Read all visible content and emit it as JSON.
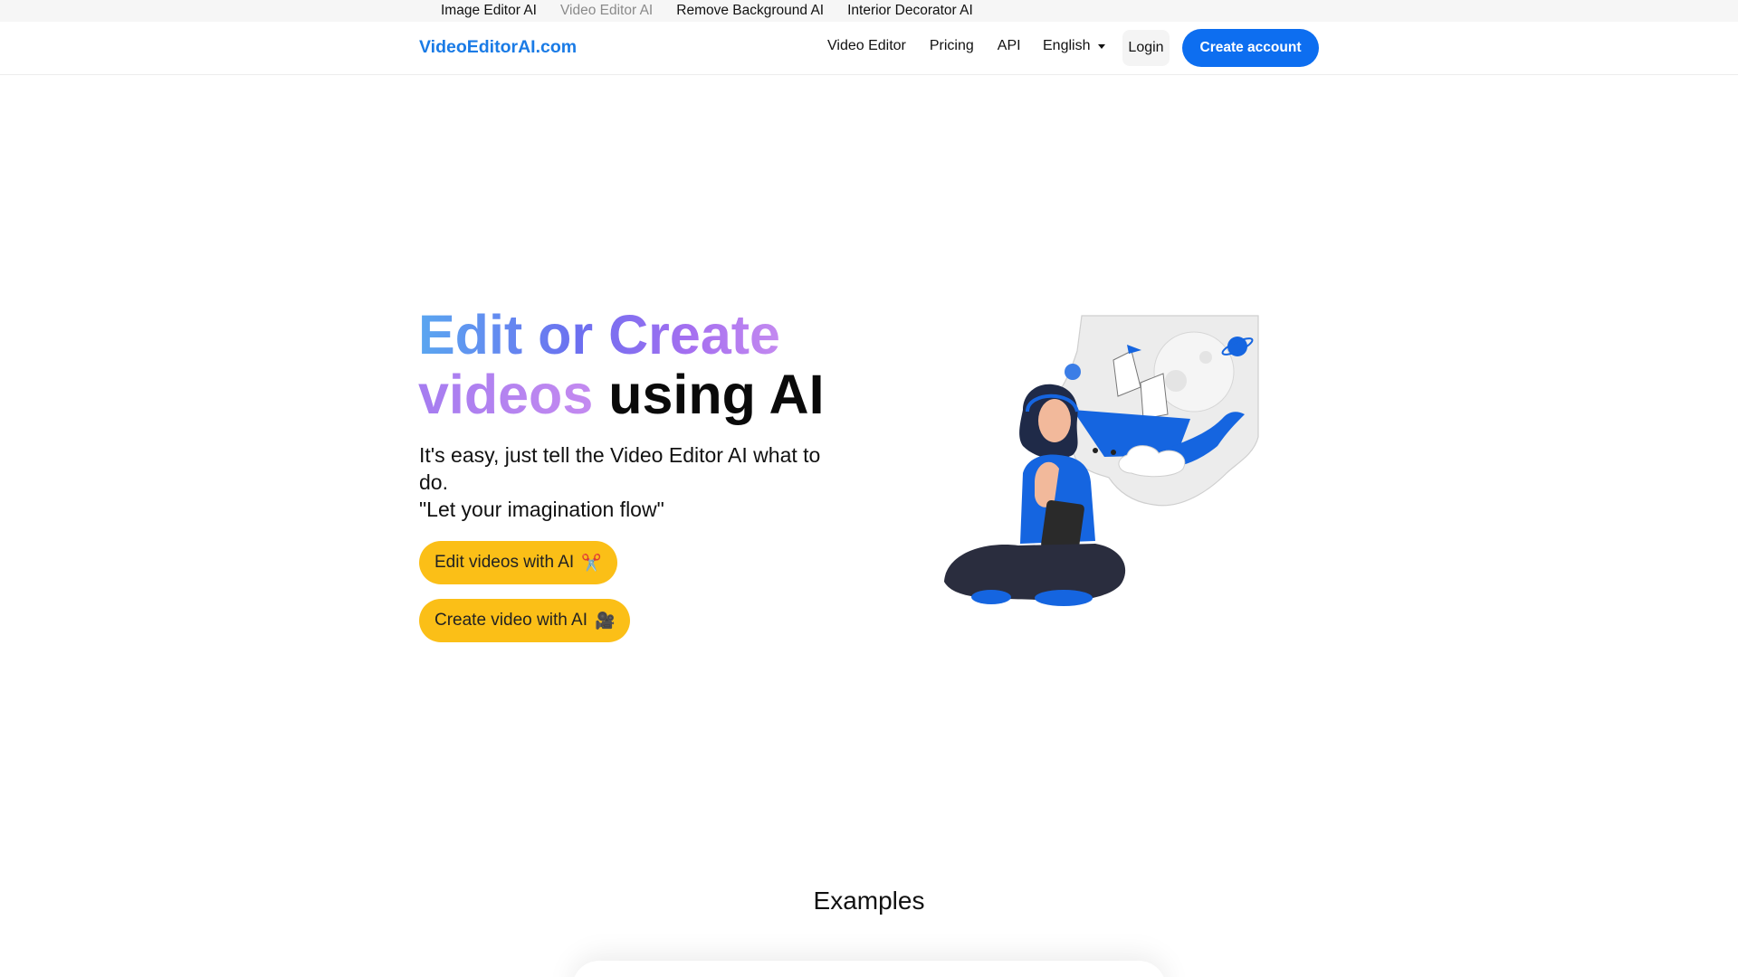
{
  "topbar": {
    "links": [
      {
        "label": "Image Editor AI"
      },
      {
        "label": "Video Editor AI"
      },
      {
        "label": "Remove Background AI"
      },
      {
        "label": "Interior Decorator AI"
      }
    ]
  },
  "navbar": {
    "brand": "VideoEditorAI.com",
    "links": [
      {
        "label": "Video Editor"
      },
      {
        "label": "Pricing"
      },
      {
        "label": "API"
      }
    ],
    "language": "English",
    "login_label": "Login",
    "create_account_label": "Create account"
  },
  "hero": {
    "title_part1": "Edit or Create",
    "title_part2": "videos",
    "title_part3": " using AI",
    "subtitle_line1": "It's easy, just tell the Video Editor AI what to do.",
    "subtitle_line2": "\"Let your imagination flow\"",
    "cta_edit": "Edit videos with AI",
    "cta_edit_emoji": "✂️",
    "cta_create": "Create video with AI",
    "cta_create_emoji": "🎥"
  },
  "examples": {
    "heading": "Examples"
  },
  "colors": {
    "brand": "#1a7be6",
    "primary_button": "#0d6ef0",
    "cta_yellow": "#fbbf17",
    "illustration_blue": "#1565e0"
  }
}
